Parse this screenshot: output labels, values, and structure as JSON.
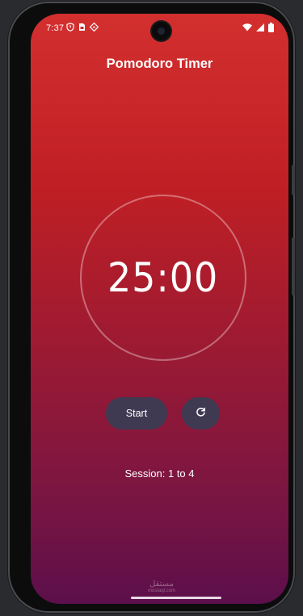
{
  "status_bar": {
    "time": "7:37",
    "left_icons": [
      "shield-icon",
      "sim-card-icon",
      "location-diamond-icon"
    ],
    "right_icons": [
      "wifi-icon",
      "signal-icon",
      "battery-icon"
    ]
  },
  "app": {
    "title": "Pomodoro Timer",
    "timer": "25:00",
    "start_label": "Start",
    "reset_icon": "refresh-icon",
    "session_text": "Session: 1 to 4"
  },
  "watermark": {
    "main": "مستقل",
    "sub": "mostaql.com"
  },
  "colors": {
    "gradient_top": "#d32f2f",
    "gradient_bottom": "#5c0f4b",
    "button_bg": "#3f3a52",
    "text": "#ffffff"
  }
}
